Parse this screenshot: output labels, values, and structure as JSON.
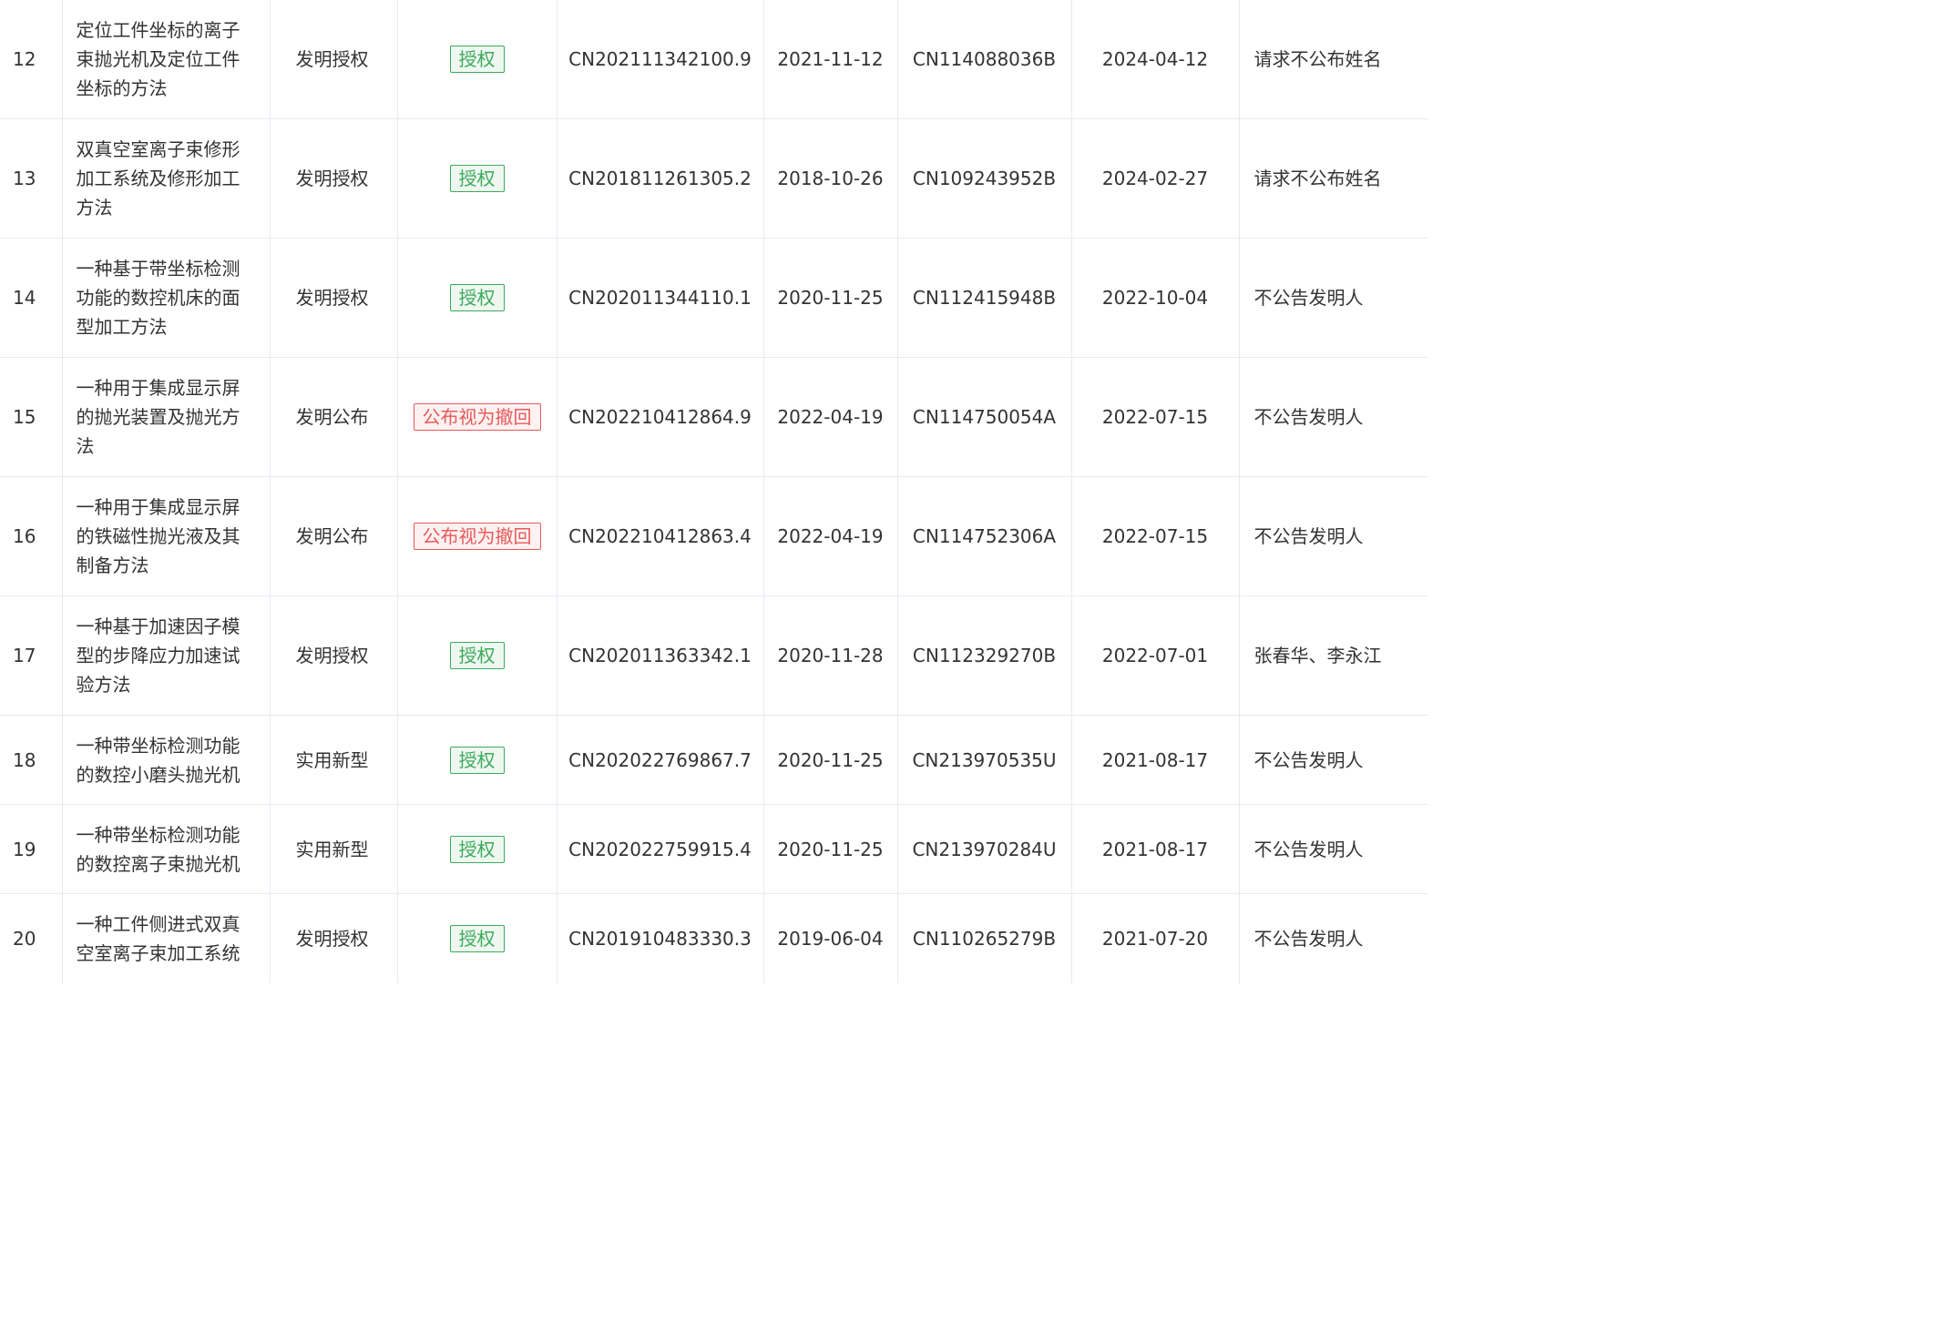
{
  "table": {
    "rows": [
      {
        "no": "12",
        "name_lines": [
          "定位工件坐标的离子",
          "束抛光机及定位工件",
          "坐标的方法"
        ],
        "type": "发明授权",
        "status": "授权",
        "status_kind": "granted",
        "app_no": "CN202111342100.9",
        "app_date": "2021-11-12",
        "pub_no": "CN114088036B",
        "pub_date": "2024-04-12",
        "inventor": "请求不公布姓名"
      },
      {
        "no": "13",
        "name_lines": [
          "双真空室离子束修形",
          "加工系统及修形加工",
          "方法"
        ],
        "type": "发明授权",
        "status": "授权",
        "status_kind": "granted",
        "app_no": "CN201811261305.2",
        "app_date": "2018-10-26",
        "pub_no": "CN109243952B",
        "pub_date": "2024-02-27",
        "inventor": "请求不公布姓名"
      },
      {
        "no": "14",
        "name_lines": [
          "一种基于带坐标检测",
          "功能的数控机床的面",
          "型加工方法"
        ],
        "type": "发明授权",
        "status": "授权",
        "status_kind": "granted",
        "app_no": "CN202011344110.1",
        "app_date": "2020-11-25",
        "pub_no": "CN112415948B",
        "pub_date": "2022-10-04",
        "inventor": "不公告发明人"
      },
      {
        "no": "15",
        "name_lines": [
          "一种用于集成显示屏",
          "的抛光装置及抛光方",
          "法"
        ],
        "type": "发明公布",
        "status": "公布视为撤回",
        "status_kind": "withdrawn",
        "app_no": "CN202210412864.9",
        "app_date": "2022-04-19",
        "pub_no": "CN114750054A",
        "pub_date": "2022-07-15",
        "inventor": "不公告发明人"
      },
      {
        "no": "16",
        "name_lines": [
          "一种用于集成显示屏",
          "的铁磁性抛光液及其",
          "制备方法"
        ],
        "type": "发明公布",
        "status": "公布视为撤回",
        "status_kind": "withdrawn",
        "app_no": "CN202210412863.4",
        "app_date": "2022-04-19",
        "pub_no": "CN114752306A",
        "pub_date": "2022-07-15",
        "inventor": "不公告发明人"
      },
      {
        "no": "17",
        "name_lines": [
          "一种基于加速因子模",
          "型的步降应力加速试",
          "验方法"
        ],
        "type": "发明授权",
        "status": "授权",
        "status_kind": "granted",
        "app_no": "CN202011363342.1",
        "app_date": "2020-11-28",
        "pub_no": "CN112329270B",
        "pub_date": "2022-07-01",
        "inventor": "张春华、李永江"
      },
      {
        "no": "18",
        "name_lines": [
          "一种带坐标检测功能",
          "的数控小磨头抛光机"
        ],
        "type": "实用新型",
        "status": "授权",
        "status_kind": "granted",
        "app_no": "CN202022769867.7",
        "app_date": "2020-11-25",
        "pub_no": "CN213970535U",
        "pub_date": "2021-08-17",
        "inventor": "不公告发明人"
      },
      {
        "no": "19",
        "name_lines": [
          "一种带坐标检测功能",
          "的数控离子束抛光机"
        ],
        "type": "实用新型",
        "status": "授权",
        "status_kind": "granted",
        "app_no": "CN202022759915.4",
        "app_date": "2020-11-25",
        "pub_no": "CN213970284U",
        "pub_date": "2021-08-17",
        "inventor": "不公告发明人"
      },
      {
        "no": "20",
        "name_lines": [
          "一种工件侧进式双真",
          "空室离子束加工系统"
        ],
        "type": "发明授权",
        "status": "授权",
        "status_kind": "granted",
        "app_no": "CN201910483330.3",
        "app_date": "2019-06-04",
        "pub_no": "CN110265279B",
        "pub_date": "2021-07-20",
        "inventor": "不公告发明人"
      }
    ]
  },
  "colors": {
    "text": "#333333",
    "border": "#e6ebf2",
    "granted": "#3daa5c",
    "withdrawn": "#e85a5a"
  }
}
